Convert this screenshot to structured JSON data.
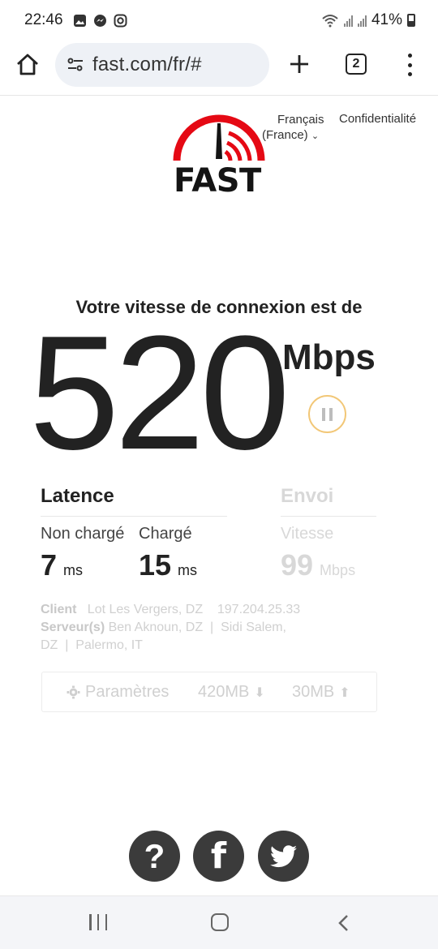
{
  "status_bar": {
    "time": "22:46",
    "battery": "41%",
    "icons": [
      "gallery-icon",
      "messenger-icon",
      "instagram-icon",
      "wifi-icon",
      "signal-icon",
      "battery-icon"
    ]
  },
  "browser": {
    "url": "fast.com/fr/#",
    "tab_count": "2",
    "icons": [
      "home-icon",
      "site-settings-icon",
      "new-tab-icon",
      "tabs-icon",
      "more-menu-icon"
    ]
  },
  "header": {
    "language_line1": "Français",
    "language_line2": "(France)",
    "privacy": "Confidentialité",
    "logo_text": "FAST"
  },
  "speed": {
    "headline": "Votre vitesse de connexion est de",
    "value": "520",
    "unit": "Mbps"
  },
  "latency": {
    "title": "Latence",
    "unloaded_label": "Non chargé",
    "unloaded_value": "7",
    "loaded_label": "Chargé",
    "loaded_value": "15",
    "unit": "ms"
  },
  "upload": {
    "title": "Envoi",
    "speed_label": "Vitesse",
    "value": "99",
    "unit": "Mbps"
  },
  "info": {
    "client_label": "Client",
    "client_location": "Lot Les Vergers, DZ",
    "client_ip": "197.204.25.33",
    "servers_label": "Serveur(s)",
    "server_1": "Ben Aknoun, DZ",
    "server_2_a": "Sidi Salem,",
    "server_2_b": "DZ",
    "server_3": "Palermo, IT",
    "separator": "|"
  },
  "settings": {
    "label": "Paramètres",
    "download_size": "420MB",
    "upload_size": "30MB"
  },
  "social": {
    "help": "?",
    "facebook": "f"
  },
  "colors": {
    "brand_red": "#e50914",
    "text_dark": "#222222",
    "muted": "#d0d0d0",
    "pause_ring": "#f2c777",
    "social_bg": "#3b3b3b"
  }
}
